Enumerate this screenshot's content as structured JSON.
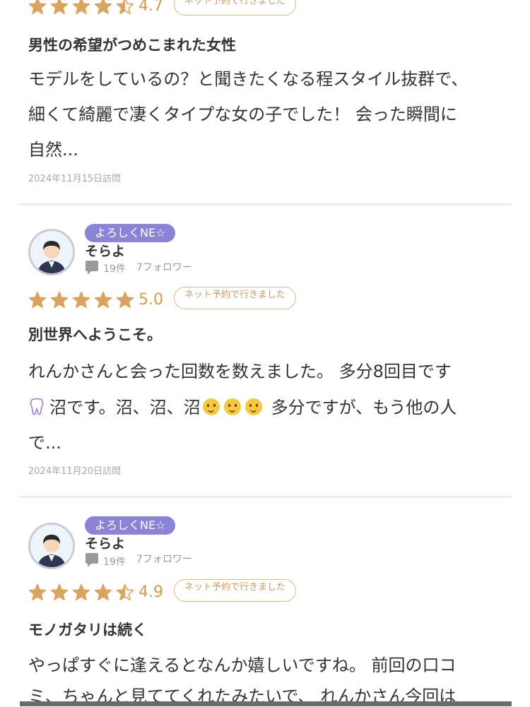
{
  "colors": {
    "star": "#d9a460",
    "accent_tag": "#8a83d6"
  },
  "review1": {
    "rating": "4.7",
    "star_fill": [
      1,
      1,
      1,
      1,
      0.5
    ],
    "badge": "ネット予約で行きました",
    "title": "男性の希望がつめこまれた女性",
    "lines": [
      "モデルをしているの？と聞きたくなる程スタイル抜群で、",
      "細くて綺麗で凄くタイプな女の子でした！ 会った瞬間に",
      "自然..."
    ],
    "date": "2024年11月15日訪問"
  },
  "review2": {
    "tag": "よろしくNE☆",
    "username": "そらよ",
    "count": "19件",
    "followers": "7フォロワー",
    "rating": "5.0",
    "star_fill": [
      1,
      1,
      1,
      1,
      1
    ],
    "badge": "ネット予約で行きました",
    "title": "別世界へようこそ。",
    "line1": "れんかさんと会った回数を数えました。 多分8回目です",
    "line2_a": "沼です。沼、沼、沼",
    "line2_b": "多分ですが、もう他の人",
    "line3": "で...",
    "date": "2024年11月20日訪問"
  },
  "review3": {
    "tag": "よろしくNE☆",
    "username": "そらよ",
    "count": "19件",
    "followers": "7フォロワー",
    "rating": "4.9",
    "star_fill": [
      1,
      1,
      1,
      1,
      0.5
    ],
    "badge": "ネット予約で行きました",
    "title": "モノガタリは続く",
    "lines": [
      "やっぱすぐに逢えるとなんか嬉しいですね。 前回の口コ",
      "ミ、ちゃんと見ててくれたみたいで、 れんかさん今回は"
    ]
  }
}
